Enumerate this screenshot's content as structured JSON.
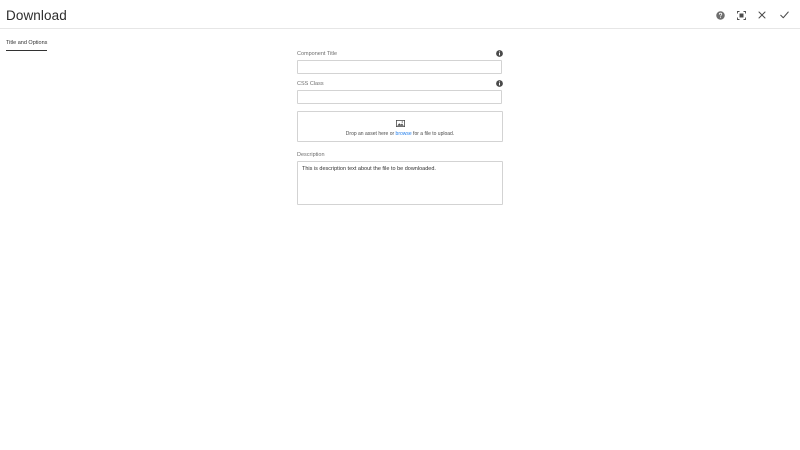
{
  "dialog": {
    "title": "Download"
  },
  "header_icons": {
    "help": "help-icon",
    "fullscreen": "fullscreen-icon",
    "close": "close-icon",
    "done": "checkmark-icon"
  },
  "tabs": [
    {
      "label": "Title and Options",
      "selected": true
    }
  ],
  "form": {
    "component_title": {
      "label": "Component Title",
      "value": "",
      "icon": "info-icon"
    },
    "css_class": {
      "label": "CSS Class",
      "value": "",
      "icon": "info-icon"
    },
    "asset_drop": {
      "icon": "image-icon",
      "text_before": "Drop an asset here or ",
      "link": "browse",
      "text_after": " for a file to upload."
    },
    "description": {
      "label": "Description",
      "value": "This is description text about the file to be downloaded."
    }
  },
  "colors": {
    "link": "#2680eb",
    "border": "#d3d3d3",
    "text": "#4b4b4b",
    "icon": "#6e6e6e"
  }
}
